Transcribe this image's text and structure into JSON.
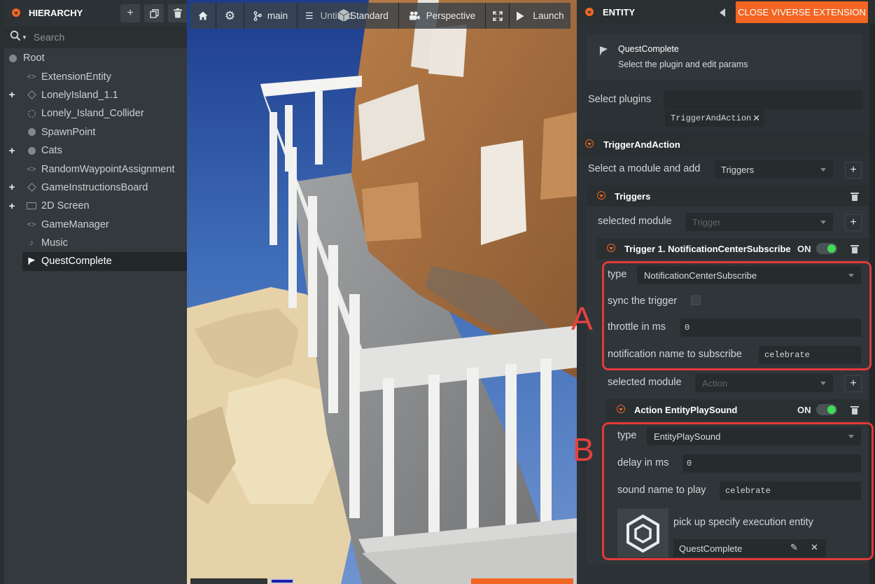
{
  "hierarchy": {
    "title": "HIERARCHY",
    "search_placeholder": "Search",
    "items": [
      {
        "label": "Root",
        "icon": "circle-icon",
        "expandable": false,
        "selected": false
      },
      {
        "label": "ExtensionEntity",
        "icon": "code-icon",
        "expandable": false,
        "selected": false
      },
      {
        "label": "LonelyIsland_1.1",
        "icon": "diamond-icon",
        "expandable": true,
        "selected": false
      },
      {
        "label": "Lonely_Island_Collider",
        "icon": "dashed-circle-icon",
        "expandable": false,
        "selected": false
      },
      {
        "label": "SpawnPoint",
        "icon": "circle-icon",
        "expandable": false,
        "selected": false
      },
      {
        "label": "Cats",
        "icon": "circle-icon",
        "expandable": true,
        "selected": false
      },
      {
        "label": "RandomWaypointAssignment",
        "icon": "code-icon",
        "expandable": false,
        "selected": false
      },
      {
        "label": "GameInstructionsBoard",
        "icon": "diamond-icon",
        "expandable": true,
        "selected": false
      },
      {
        "label": "2D Screen",
        "icon": "screen-icon",
        "expandable": true,
        "selected": false
      },
      {
        "label": "GameManager",
        "icon": "code-icon",
        "expandable": false,
        "selected": false
      },
      {
        "label": "Music",
        "icon": "music-icon",
        "expandable": false,
        "selected": false
      },
      {
        "label": "QuestComplete",
        "icon": "flag-icon",
        "expandable": false,
        "selected": true
      }
    ]
  },
  "viewport": {
    "toolbar": {
      "branch": "main",
      "scene": "Untitled",
      "mode": "Standard",
      "camera": "Perspective",
      "launch": "Launch"
    }
  },
  "entity": {
    "title": "ENTITY",
    "close_button": "CLOSE VIVERSE EXTENSION",
    "entity_name": "QuestComplete",
    "entity_hint": "Select the plugin and edit params",
    "select_plugins_label": "Select plugins",
    "plugin_tag": "TriggerAndAction",
    "plugin_section": "TriggerAndAction",
    "select_module_label": "Select a module and add",
    "module_dropdown": "Triggers",
    "triggers_section": "Triggers",
    "selected_module_label": "selected module",
    "trigger_module_dropdown": "Trigger",
    "trigger_title": "Trigger 1. NotificationCenterSubscribe",
    "on_label": "ON",
    "trigger": {
      "type_label": "type",
      "type_value": "NotificationCenterSubscribe",
      "sync_label": "sync the trigger",
      "throttle_label": "throttle in ms",
      "throttle_value": "0",
      "notify_label": "notification name to subscribe",
      "notify_value": "celebrate"
    },
    "action_selected_module_label": "selected module",
    "action_module_dropdown": "Action",
    "action_title": "Action EntityPlaySound",
    "action": {
      "type_label": "type",
      "type_value": "EntityPlaySound",
      "delay_label": "delay in ms",
      "delay_value": "0",
      "sound_label": "sound name to play",
      "sound_value": "celebrate",
      "pick_label": "pick up specify execution entity",
      "pick_value": "QuestComplete"
    }
  },
  "annotations": {
    "a": "A",
    "b": "B"
  },
  "colors": {
    "accent": "#f26522",
    "highlight": "#e33a3a",
    "toggle_on": "#3fdc55"
  }
}
